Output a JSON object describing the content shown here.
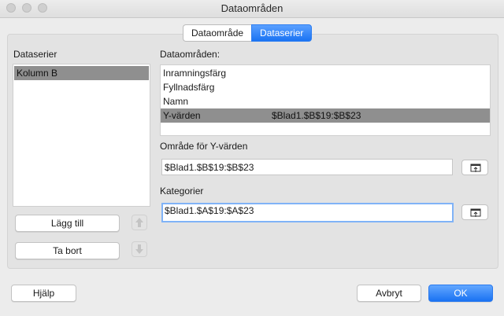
{
  "window": {
    "title": "Dataområden"
  },
  "tabs": [
    {
      "label": "Dataområde"
    },
    {
      "label": "Dataserier"
    }
  ],
  "series_panel": {
    "label": "Dataserier",
    "items": [
      {
        "label": "Kolumn B"
      }
    ]
  },
  "ranges_panel": {
    "label": "Dataområden:",
    "items": [
      {
        "name": "Inramningsfärg",
        "range": ""
      },
      {
        "name": "Fyllnadsfärg",
        "range": ""
      },
      {
        "name": "Namn",
        "range": ""
      },
      {
        "name": "Y-värden",
        "range": "$Blad1.$B$19:$B$23"
      }
    ]
  },
  "y_range": {
    "label": "Område för Y-värden",
    "value": "$Blad1.$B$19:$B$23"
  },
  "categories": {
    "label": "Kategorier",
    "value": "$Blad1.$A$19:$A$23"
  },
  "buttons": {
    "add": "Lägg till",
    "remove": "Ta bort",
    "help": "Hjälp",
    "cancel": "Avbryt",
    "ok": "OK"
  },
  "icons": {
    "move_up": "arrow-up-icon",
    "move_down": "arrow-down-icon",
    "range_select": "select-range-icon"
  }
}
